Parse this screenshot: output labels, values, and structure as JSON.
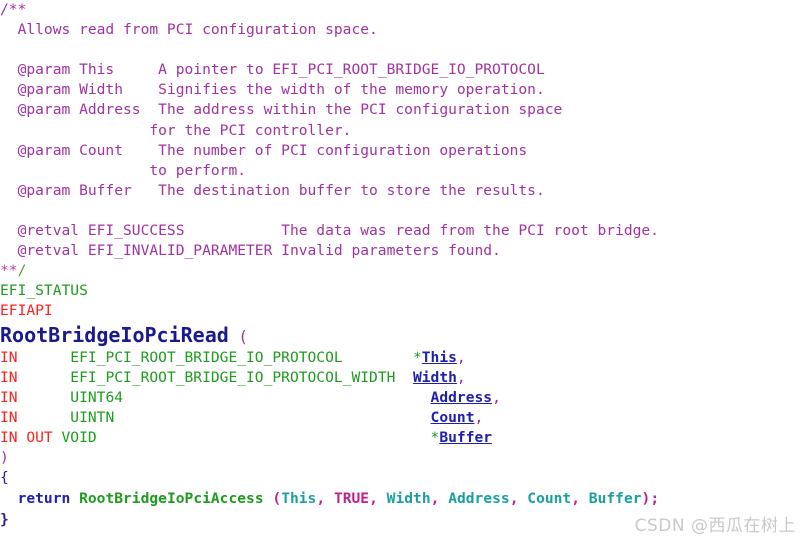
{
  "editor": {
    "background_color": "#ffffff",
    "font": "monospace",
    "language": "c"
  },
  "colors": {
    "comment": "#a033a0",
    "type": "#1f9b1f",
    "macro_red": "#ff2020",
    "function_name": "#1a1a8c",
    "parameter": "#2020b0",
    "punctuation": "#a033a0",
    "keyword": "#2020b0",
    "argument": "#1aa0a0",
    "boolean": "#c02090",
    "watermark": "#c9c9c9"
  },
  "code": {
    "comment_block": {
      "open": "/**",
      "summary": "  Allows read from PCI configuration space.",
      "params": [
        {
          "tag": "  @param This",
          "desc": "     A pointer to EFI_PCI_ROOT_BRIDGE_IO_PROTOCOL"
        },
        {
          "tag": "  @param Width",
          "desc": "    Signifies the width of the memory operation."
        },
        {
          "tag": "  @param Address",
          "desc": "  The address within the PCI configuration space"
        },
        {
          "tag": "",
          "desc": "                 for the PCI controller."
        },
        {
          "tag": "  @param Count",
          "desc": "    The number of PCI configuration operations"
        },
        {
          "tag": "",
          "desc": "                 to perform."
        },
        {
          "tag": "  @param Buffer",
          "desc": "   The destination buffer to store the results."
        }
      ],
      "retvals": [
        {
          "tag": "  @retval EFI_SUCCESS",
          "desc": "           The data was read from the PCI root bridge."
        },
        {
          "tag": "  @retval EFI_INVALID_PARAMETER",
          "desc": " Invalid parameters found."
        }
      ],
      "close_stars": "**",
      "close_slash": "/"
    },
    "return_type": "EFI_STATUS",
    "calling_convention": "EFIAPI",
    "function_name": "RootBridgeIoPciRead",
    "open_paren": "(",
    "parameters": [
      {
        "direction": "IN",
        "type": "EFI_PCI_ROOT_BRIDGE_IO_PROTOCOL",
        "pointer": "*",
        "name": "This",
        "comma": ","
      },
      {
        "direction": "IN",
        "type": "EFI_PCI_ROOT_BRIDGE_IO_PROTOCOL_WIDTH",
        "pointer": "",
        "name": "Width",
        "comma": ","
      },
      {
        "direction": "IN",
        "type": "UINT64",
        "pointer": "",
        "name": "Address",
        "comma": ","
      },
      {
        "direction": "IN",
        "type": "UINTN",
        "pointer": "",
        "name": "Count",
        "comma": ","
      },
      {
        "direction": "IN OUT",
        "type": "VOID",
        "pointer": "*",
        "name": "Buffer",
        "comma": ""
      }
    ],
    "close_paren": ")",
    "open_brace": "{",
    "body": {
      "keyword": "return",
      "call_name": "RootBridgeIoPciAccess",
      "lparen": "(",
      "args": [
        "This",
        "TRUE",
        "Width",
        "Address",
        "Count",
        "Buffer"
      ],
      "rparen": ")",
      "semicolon": ";"
    },
    "close_brace": "}"
  },
  "watermark": {
    "text": "CSDN @西瓜在树上"
  }
}
